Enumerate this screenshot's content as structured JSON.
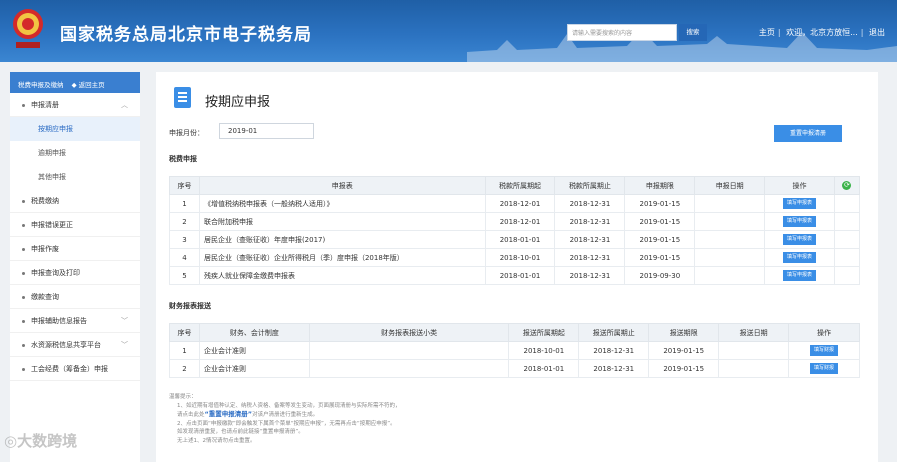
{
  "header": {
    "title": "国家税务总局北京市电子税务局",
    "search_placeholder": "请输入需要搜索的内容",
    "search_button": "搜索",
    "links": [
      "主页",
      "欢迎，北京方放恒...",
      "退出"
    ]
  },
  "sidebar": {
    "head_label": "税费申报及缴纳",
    "back_label": "返回主页",
    "items": [
      {
        "label": "申报清册",
        "expanded": true,
        "children": [
          "按期应申报",
          "逾期申报",
          "其他申报"
        ],
        "active_child": "按期应申报"
      },
      {
        "label": "税费缴纳"
      },
      {
        "label": "申报错误更正"
      },
      {
        "label": "申报作废"
      },
      {
        "label": "申报查询及打印"
      },
      {
        "label": "缴款查询"
      },
      {
        "label": "申报辅助信息报告",
        "has_chevron": true
      },
      {
        "label": "水资源税信息共享平台",
        "has_chevron": true
      },
      {
        "label": "工会经费（筹备金）申报"
      }
    ]
  },
  "main": {
    "page_title": "按期应申报",
    "period_label": "申报月份：",
    "period_value": "2019-01",
    "reset_button": "重置申报清册",
    "tax_section_title": "税费申报",
    "tax_table": {
      "headers": [
        "序号",
        "申报表",
        "税款所属期起",
        "税款所属期止",
        "申报期限",
        "申报日期",
        "操作"
      ],
      "rows": [
        [
          "1",
          "《增值税纳税申报表（一般纳税人适用）》",
          "2018-12-01",
          "2018-12-31",
          "2019-01-15",
          "",
          "填写申报表"
        ],
        [
          "2",
          "联合附加税申报",
          "2018-12-01",
          "2018-12-31",
          "2019-01-15",
          "",
          "填写申报表"
        ],
        [
          "3",
          "居民企业（查账征收）年度申报(2017)",
          "2018-01-01",
          "2018-12-31",
          "2019-01-15",
          "",
          "填写申报表"
        ],
        [
          "4",
          "居民企业（查账征收）企业所得税月（季）度申报（2018年版）",
          "2018-10-01",
          "2018-12-31",
          "2019-01-15",
          "",
          "填写申报表"
        ],
        [
          "5",
          "残疾人就业保障金缴费申报表",
          "2018-01-01",
          "2018-12-31",
          "2019-09-30",
          "",
          "填写申报表"
        ]
      ]
    },
    "fin_section_title": "财务报表报送",
    "fin_table": {
      "headers": [
        "序号",
        "财务、会计制度",
        "财务报表报送小类",
        "报送所属期起",
        "报送所属期止",
        "报送期限",
        "报送日期",
        "操作"
      ],
      "rows": [
        [
          "1",
          "企业会计准则",
          "",
          "2018-10-01",
          "2018-12-31",
          "2019-01-15",
          "",
          "填写财报"
        ],
        [
          "2",
          "企业会计准则",
          "",
          "2018-01-01",
          "2018-12-31",
          "2019-01-15",
          "",
          "填写财报"
        ]
      ]
    },
    "tips": {
      "title": "温馨提示：",
      "line1": "1、如近期有增值种认定、纳税人资格、备案等发生变动，页面展现清册与实际所需不符的，",
      "line2_pre": "请点击此处",
      "line2_hl": "“重置申报清册”",
      "line2_post": "对该户清册进行重新生成。",
      "line3": "2、点击页面“申报缴款”即会触发下属首个菜单“按期应申报”，无需再点击“按期应申报”。",
      "line4": "如发现清册重复，也请点前此链接“重置申报清册”。",
      "line5": "无上述1、2情况请勿点击重置。"
    }
  },
  "watermark": "大数跨境"
}
